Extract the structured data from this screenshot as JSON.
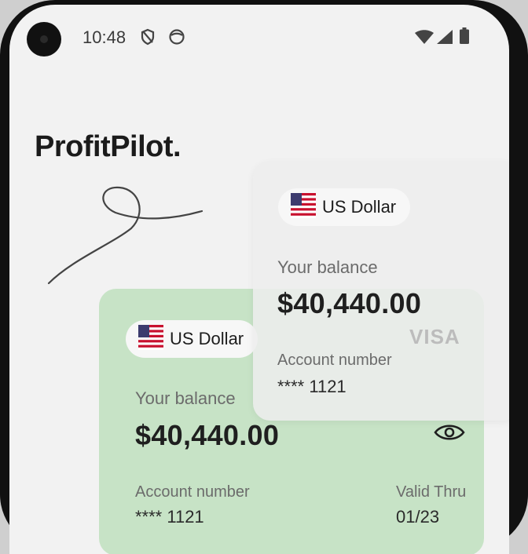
{
  "status_bar": {
    "time": "10:48",
    "left_icons": [
      "shield-slash-icon",
      "face-icon"
    ],
    "right_icons": [
      "wifi-icon",
      "signal-icon",
      "battery-icon"
    ]
  },
  "app": {
    "brand": "ProfitPilot."
  },
  "cards": [
    {
      "name": "front-glass-card",
      "currency_label": "US Dollar",
      "balance_label": "Your balance",
      "balance": "$40,440.00",
      "network": "VISA",
      "account_label": "Account number",
      "account_number": "**** 1121"
    },
    {
      "name": "back-green-card",
      "currency_label": "US Dollar",
      "balance_label": "Your balance",
      "balance": "$40,440.00",
      "account_label": "Account number",
      "account_number": "**** 1121",
      "valid_label": "Valid Thru",
      "valid_value": "01/23"
    }
  ],
  "colors": {
    "green_card": "#c7e3c6",
    "glass_card": "#eeeeee",
    "background": "#f2f2f2",
    "text_dark": "#1f1f1f"
  }
}
